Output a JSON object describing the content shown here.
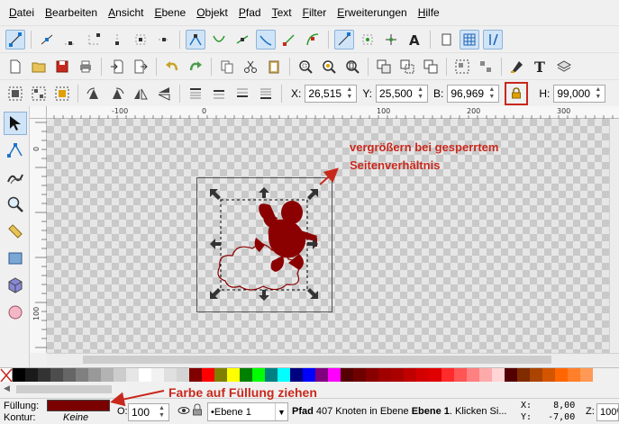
{
  "menu": [
    {
      "u": "D",
      "rest": "atei"
    },
    {
      "u": "B",
      "rest": "earbeiten"
    },
    {
      "u": "A",
      "rest": "nsicht"
    },
    {
      "u": "E",
      "rest": "bene"
    },
    {
      "u": "O",
      "rest": "bjekt"
    },
    {
      "u": "P",
      "rest": "fad"
    },
    {
      "u": "T",
      "rest": "ext"
    },
    {
      "u": "F",
      "rest": "ilter"
    },
    {
      "u": "E",
      "rest": "rweiterungen"
    },
    {
      "u": "H",
      "rest": "ilfe"
    }
  ],
  "transform": {
    "x_label": "X:",
    "x_value": "26,515",
    "y_label": "Y:",
    "y_value": "25,500",
    "w_label": "B:",
    "w_value": "96,969",
    "h_label": "H:",
    "h_value": "99,000",
    "lock_icon": "padlock-icon"
  },
  "rulers": {
    "h_labels": [
      "-100",
      "0",
      "100",
      "200",
      "300"
    ],
    "v_labels": [
      "0",
      "100"
    ]
  },
  "annotations": {
    "top_line1": "vergrößern bei gesperrtem",
    "top_line2": "Seitenverhältnis",
    "bottom": "Farbe auf Füllung ziehen",
    "color": "#c8281c"
  },
  "status": {
    "fill_label": "Füllung:",
    "stroke_label": "Kontur:",
    "stroke_value": "Keine",
    "fill_color": "#7b0000",
    "opacity_label": "O:",
    "opacity_value": "100",
    "layer_value": "•Ebene 1",
    "msg_obj": "Pfad",
    "msg_mid": " 407 Knoten in Ebene ",
    "msg_layer": "Ebene 1",
    "msg_tail": ". Klicken Si...",
    "x_label": "X:",
    "x_value": "8,00",
    "y_label": "Y:",
    "y_value": "-7,00",
    "zoom_label": "Z:",
    "zoom_value": "100%"
  },
  "palette": [
    "#000000",
    "#1a1a1a",
    "#333333",
    "#4d4d4d",
    "#666666",
    "#808080",
    "#999999",
    "#b3b3b3",
    "#cccccc",
    "#e6e6e6",
    "#ffffff",
    "#f2f2f2",
    "#e0e0e0",
    "#d4d4d4",
    "#800000",
    "#ff0000",
    "#808000",
    "#ffff00",
    "#008000",
    "#00ff00",
    "#008080",
    "#00ffff",
    "#000080",
    "#0000ff",
    "#800080",
    "#ff00ff",
    "#550000",
    "#6e0000",
    "#880000",
    "#a00000",
    "#aa0000",
    "#c00000",
    "#d40000",
    "#e00000",
    "#ff2a2a",
    "#ff5555",
    "#ff8080",
    "#ffaaaa",
    "#ffd5d5",
    "#550000",
    "#802b00",
    "#aa4400",
    "#d45500",
    "#ff6600",
    "#ff7f2a",
    "#ff9955"
  ]
}
